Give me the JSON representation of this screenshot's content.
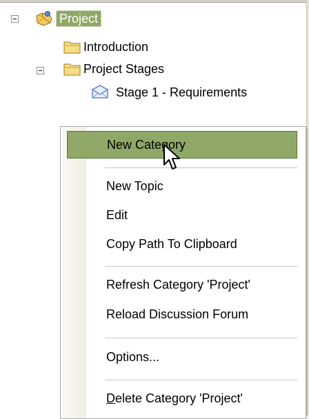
{
  "tree": {
    "root": {
      "label": "Project",
      "selected": true,
      "expanded": true
    },
    "items": [
      {
        "label": "Introduction",
        "icon": "folder-icon"
      },
      {
        "label": "Project Stages",
        "icon": "folder-icon",
        "expanded": true
      },
      {
        "label": "Stage 1 - Requirements",
        "icon": "topic-envelope-icon"
      }
    ]
  },
  "context_menu": {
    "items": [
      {
        "label": "New Category",
        "highlighted": true
      },
      {
        "label": "New Topic"
      },
      {
        "label": "Edit"
      },
      {
        "label": "Copy Path To Clipboard"
      },
      {
        "label": "Refresh Category 'Project'"
      },
      {
        "label": "Reload Discussion Forum"
      },
      {
        "label": "Options..."
      },
      {
        "label": "Delete Category 'Project'"
      }
    ]
  },
  "colors": {
    "selection": "#8fa867",
    "selection_border": "#55752e",
    "menu_gutter": "#f0ede2",
    "folder": "#f5d86a"
  }
}
